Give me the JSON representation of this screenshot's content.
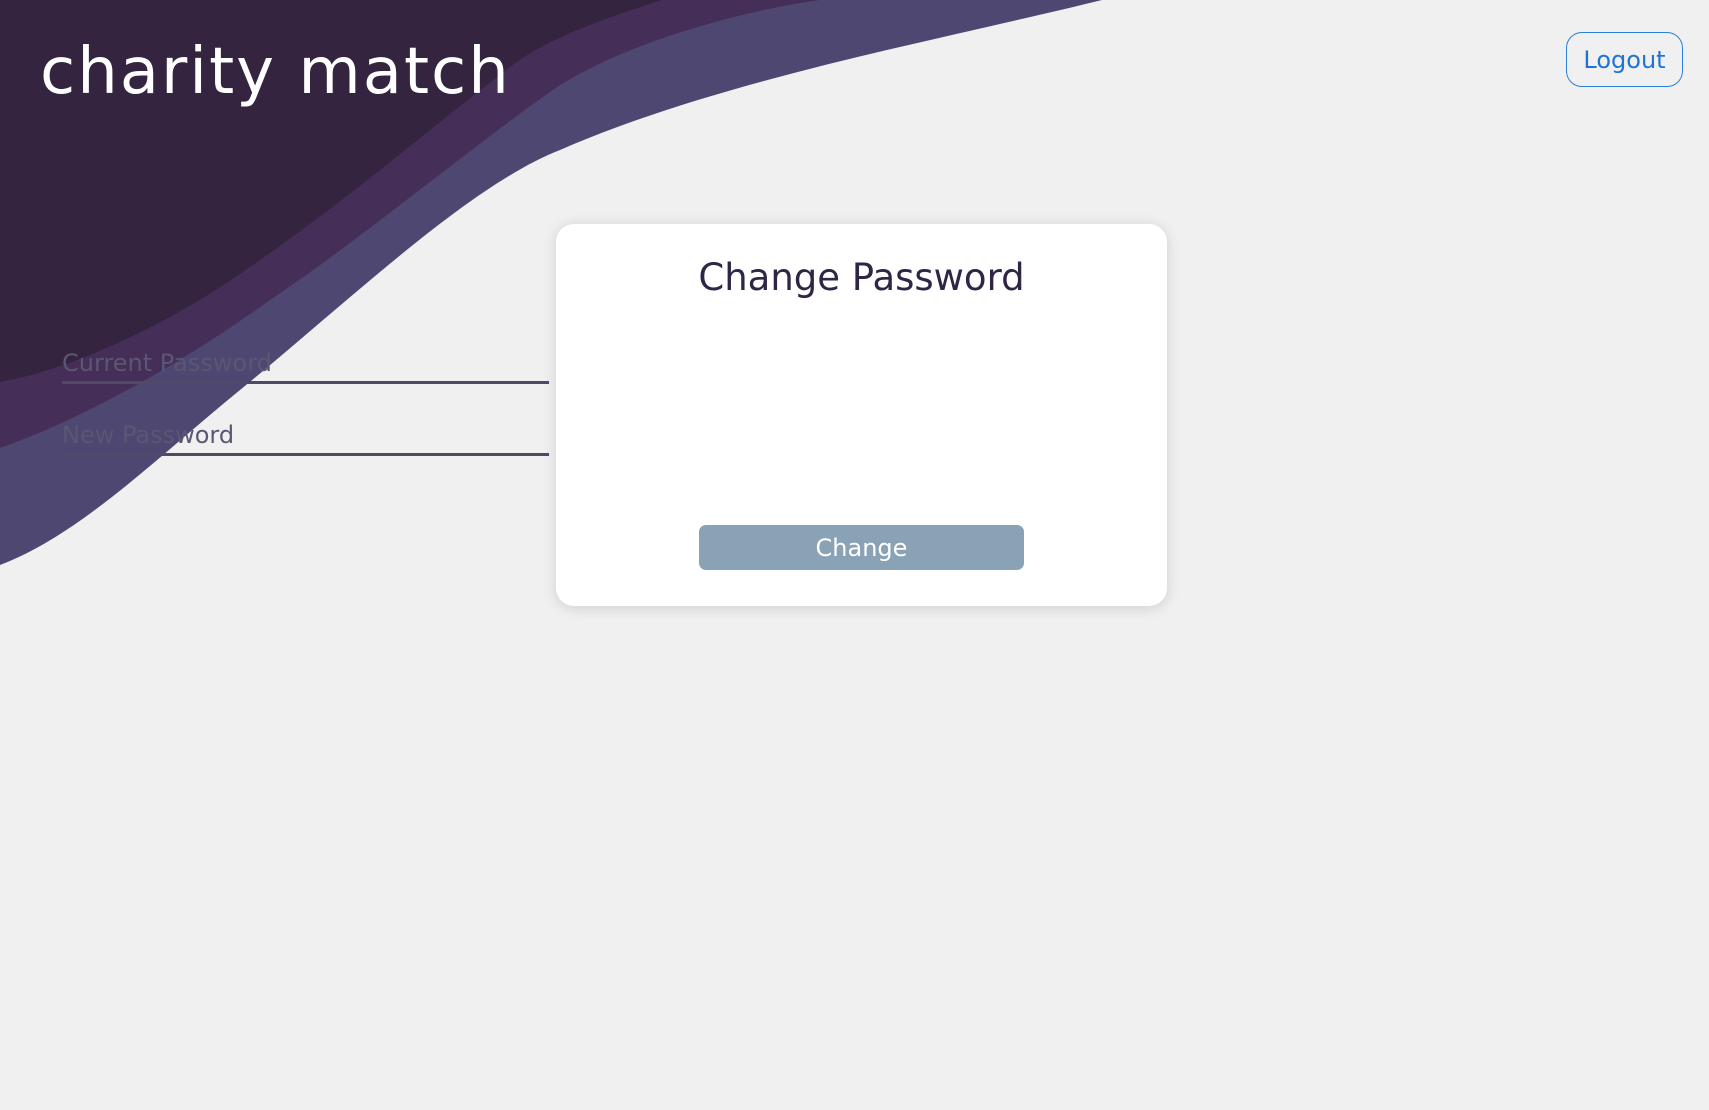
{
  "app": {
    "brand_name": "charity match"
  },
  "header": {
    "logout_label": "Logout"
  },
  "form": {
    "title": "Change Password",
    "current_password_placeholder": "Current Password",
    "current_password_value": "",
    "new_password_placeholder": "New Password",
    "new_password_value": "",
    "submit_label": "Change"
  },
  "theme": {
    "wave_dark": "#34243f",
    "wave_mid": "#452e57",
    "wave_light": "#4e4771",
    "page_background": "#f0f0f1",
    "accent_link": "#1e74d6",
    "button_fill": "#8aa2b6",
    "card_background": "#ffffff",
    "title_color": "#2f2544"
  }
}
